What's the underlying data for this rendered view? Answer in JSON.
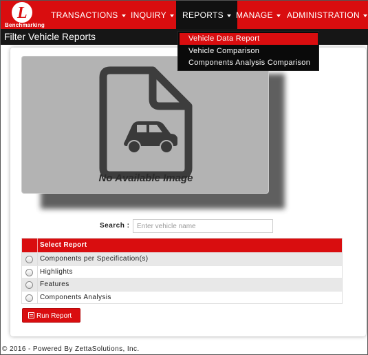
{
  "brand": {
    "logo_letter": "L",
    "logo_text": "Benchmarking"
  },
  "nav": {
    "items": [
      {
        "label": "TRANSACTIONS"
      },
      {
        "label": "INQUIRY"
      },
      {
        "label": "REPORTS"
      },
      {
        "label": "MANAGE"
      },
      {
        "label": "ADMINISTRATION"
      }
    ],
    "active": "REPORTS"
  },
  "reports_menu": {
    "items": [
      "Vehicle Data Report",
      "Vehicle Comparison",
      "Components Analysis Comparison"
    ],
    "selected": "Vehicle Data Report"
  },
  "page": {
    "title": "Filter Vehicle Reports"
  },
  "image": {
    "placeholder_text": "No Available Image",
    "icon": "car-file-icon"
  },
  "search": {
    "label": "Search :",
    "placeholder": "Enter vehicle name",
    "value": ""
  },
  "report_table": {
    "header": "Select Report",
    "rows": [
      {
        "label": "Components per Specification(s)"
      },
      {
        "label": "Highlights"
      },
      {
        "label": "Features"
      },
      {
        "label": "Components Analysis"
      }
    ]
  },
  "run_button": {
    "label": "Run Report",
    "icon": "report-icon"
  },
  "footer": {
    "text": "© 2016 - Powered By ZettaSolutions, Inc."
  },
  "colors": {
    "brand_red": "#d90d0f",
    "dark": "#111111"
  }
}
